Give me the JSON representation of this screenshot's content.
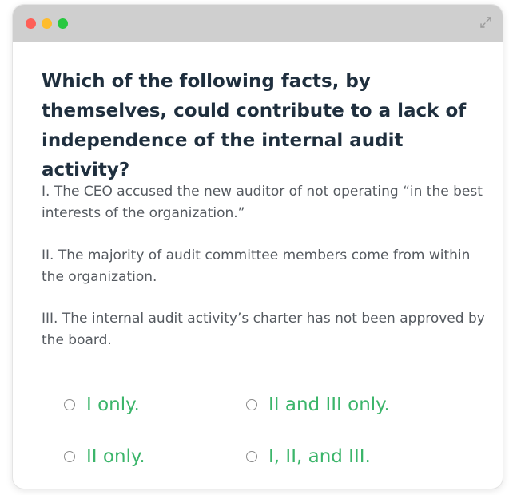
{
  "window": {
    "traffic_lights": [
      "close",
      "minimize",
      "zoom"
    ],
    "expand_icon": "expand-arrows-icon"
  },
  "quiz": {
    "question": "Which of the following facts, by themselves, could contribute to a lack of independence of the internal audit activity?",
    "statements": [
      "I. The CEO accused the new auditor of not operating “in the best interests of the organization.”",
      "II. The majority of audit committee members come from within the organization.",
      "III. The internal audit activity’s charter has not been approved by the board."
    ],
    "options": [
      {
        "label": "I only."
      },
      {
        "label": "II and III only."
      },
      {
        "label": "II only."
      },
      {
        "label": "I, II, and III."
      }
    ]
  },
  "colors": {
    "titlebar": "#cfcfcf",
    "question_text": "#1f2f3e",
    "statement_text": "#555a60",
    "option_text": "#3bb56a",
    "close": "#fe5f57",
    "minimize": "#febc2e",
    "zoom": "#28c840"
  }
}
